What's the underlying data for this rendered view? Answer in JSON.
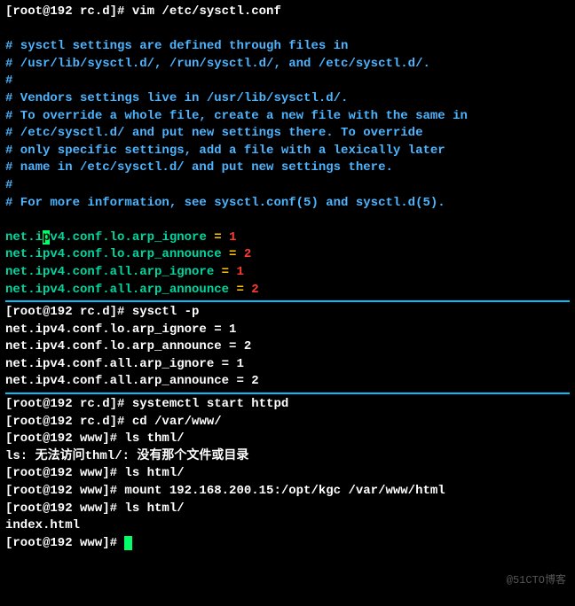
{
  "section1": {
    "prompt": "[root@192 rc.d]# ",
    "cmd": "vim /etc/sysctl.conf",
    "comments": [
      "# sysctl settings are defined through files in",
      "# /usr/lib/sysctl.d/, /run/sysctl.d/, and /etc/sysctl.d/.",
      "#",
      "# Vendors settings live in /usr/lib/sysctl.d/.",
      "# To override a whole file, create a new file with the same in",
      "# /etc/sysctl.d/ and put new settings there. To override",
      "# only specific settings, add a file with a lexically later",
      "# name in /etc/sysctl.d/ and put new settings there.",
      "#",
      "# For more information, see sysctl.conf(5) and sysctl.d(5)."
    ],
    "settings": [
      {
        "key_pre": "net.i",
        "key_cursor": "p",
        "key_post": "v4.conf.lo.arp_ignore",
        "eq": " = ",
        "val": "1"
      },
      {
        "key": "net.ipv4.conf.lo.arp_announce",
        "eq": " = ",
        "val": "2"
      },
      {
        "key": "net.ipv4.conf.all.arp_ignore",
        "eq": " = ",
        "val": "1"
      },
      {
        "key": "net.ipv4.conf.all.arp_announce",
        "eq": " = ",
        "val": "2"
      }
    ]
  },
  "section2": {
    "prompt": "[root@192 rc.d]# ",
    "cmd": "sysctl -p",
    "output": [
      "net.ipv4.conf.lo.arp_ignore = 1",
      "net.ipv4.conf.lo.arp_announce = 2",
      "net.ipv4.conf.all.arp_ignore = 1",
      "net.ipv4.conf.all.arp_announce = 2"
    ]
  },
  "section3": {
    "lines": [
      {
        "prompt": "[root@192 rc.d]# ",
        "cmd": "systemctl start httpd"
      },
      {
        "prompt": "[root@192 rc.d]# ",
        "cmd": "cd /var/www/"
      },
      {
        "prompt": "[root@192 www]# ",
        "cmd": "ls thml/"
      }
    ],
    "error": "ls: 无法访问thml/: 没有那个文件或目录",
    "lines2": [
      {
        "prompt": "[root@192 www]# ",
        "cmd": "ls html/"
      },
      {
        "prompt": "[root@192 www]# ",
        "cmd": "mount 192.168.200.15:/opt/kgc /var/www/html"
      },
      {
        "prompt": "[root@192 www]# ",
        "cmd": "ls html/"
      }
    ],
    "output2": "index.html",
    "final_prompt": "[root@192 www]# "
  },
  "watermark": "@51CTO博客"
}
